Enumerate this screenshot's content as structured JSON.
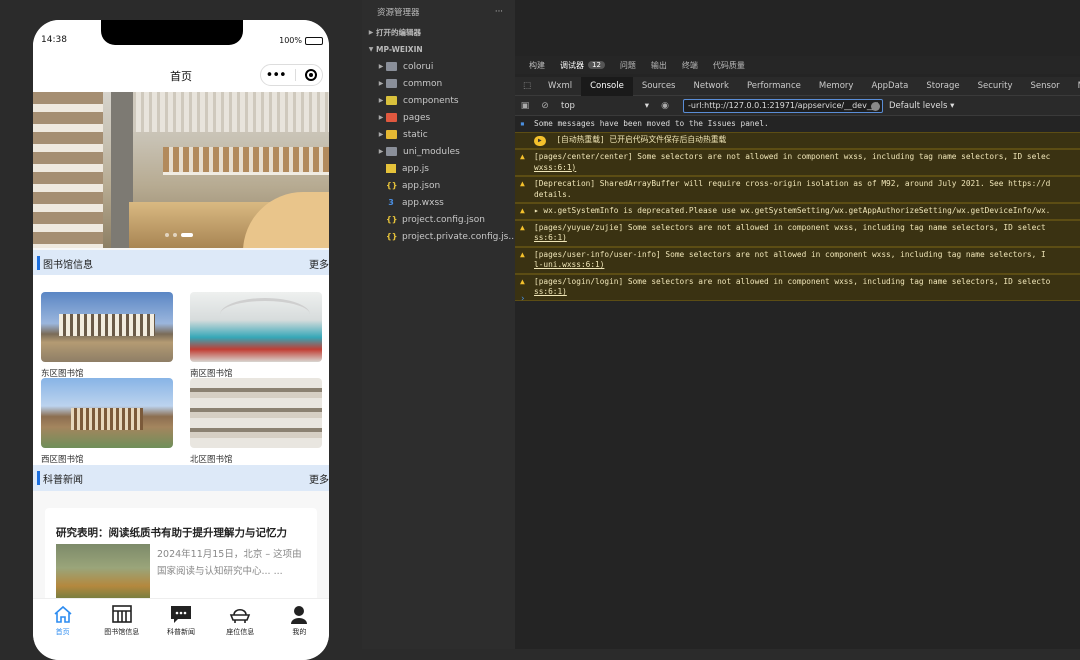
{
  "phone": {
    "time": "14:38",
    "battery": "100%",
    "nav_title": "首页",
    "banner_active_index": 2,
    "sections": {
      "library_title": "图书馆信息",
      "library_more": "更多",
      "news_title": "科普新闻",
      "news_more": "更多"
    },
    "libraries": [
      {
        "name": "东区图书馆"
      },
      {
        "name": "南区图书馆"
      },
      {
        "name": "西区图书馆"
      },
      {
        "name": "北区图书馆"
      }
    ],
    "news": {
      "title": "研究表明：阅读纸质书有助于提升理解力与记忆力",
      "desc": "2024年11月15日，北京 – 这项由国家阅读与认知研究中心... ..."
    },
    "tabs": [
      {
        "label": "首页",
        "icon": "home-icon",
        "active": true
      },
      {
        "label": "图书馆信息",
        "icon": "bookshelf-icon",
        "active": false
      },
      {
        "label": "科普新闻",
        "icon": "chat-icon",
        "active": false
      },
      {
        "label": "座位信息",
        "icon": "seat-icon",
        "active": false
      },
      {
        "label": "我的",
        "icon": "user-icon",
        "active": false
      }
    ]
  },
  "explorer": {
    "header": "资源管理器",
    "open_editors": "打开的编辑器",
    "project": "MP-WEIXIN",
    "folders": [
      "colorui",
      "common",
      "components",
      "pages",
      "static",
      "uni_modules"
    ],
    "files": [
      "app.js",
      "app.json",
      "app.wxss",
      "project.config.json",
      "project.private.config.js..."
    ]
  },
  "devtools": {
    "top_tabs": [
      {
        "label": "构建"
      },
      {
        "label": "调试器",
        "badge": "12",
        "active": true
      },
      {
        "label": "问题"
      },
      {
        "label": "输出"
      },
      {
        "label": "终端"
      },
      {
        "label": "代码质量"
      }
    ],
    "panel_tabs": [
      "Wxml",
      "Console",
      "Sources",
      "Network",
      "Performance",
      "Memory",
      "AppData",
      "Storage",
      "Security",
      "Sensor",
      "Mo"
    ],
    "active_panel": "Console",
    "context": "top",
    "filter_value": "-url:http://127.0.0.1:21971/appservice/__dev__/",
    "levels": "Default levels",
    "messages": [
      {
        "type": "info",
        "text": "Some messages have been moved to the Issues panel."
      },
      {
        "type": "warn",
        "badge": "",
        "text": "[自动热重载] 已开启代码文件保存后自动热重载"
      },
      {
        "type": "warn",
        "text": "[pages/center/center] Some selectors are not allowed in component wxss, including tag name selectors, ID selec",
        "text2": "wxss:6:1)"
      },
      {
        "type": "warn",
        "text": "[Deprecation] SharedArrayBuffer will require cross-origin isolation as of M92, around July 2021. See https://d",
        "text2": "details."
      },
      {
        "type": "warn",
        "text": "▸ wx.getSystemInfo is deprecated.Please use wx.getSystemSetting/wx.getAppAuthorizeSetting/wx.getDeviceInfo/wx."
      },
      {
        "type": "warn",
        "text": "[pages/yuyue/zujie] Some selectors are not allowed in component wxss, including tag name selectors, ID select",
        "text2": "ss:6:1)"
      },
      {
        "type": "warn",
        "text": "[pages/user-info/user-info] Some selectors are not allowed in component wxss, including tag name selectors, I",
        "text2": "l-uni.wxss:6:1)"
      },
      {
        "type": "warn",
        "text": "[pages/login/login] Some selectors are not allowed in component wxss, including tag name selectors, ID selecto",
        "text2": "ss:6:1)"
      }
    ]
  },
  "colors": {
    "accent": "#2d8cf0",
    "section_bg": "#dde9f8",
    "warn_bg": "#3a3212",
    "warn_icon": "#f4c12c"
  }
}
